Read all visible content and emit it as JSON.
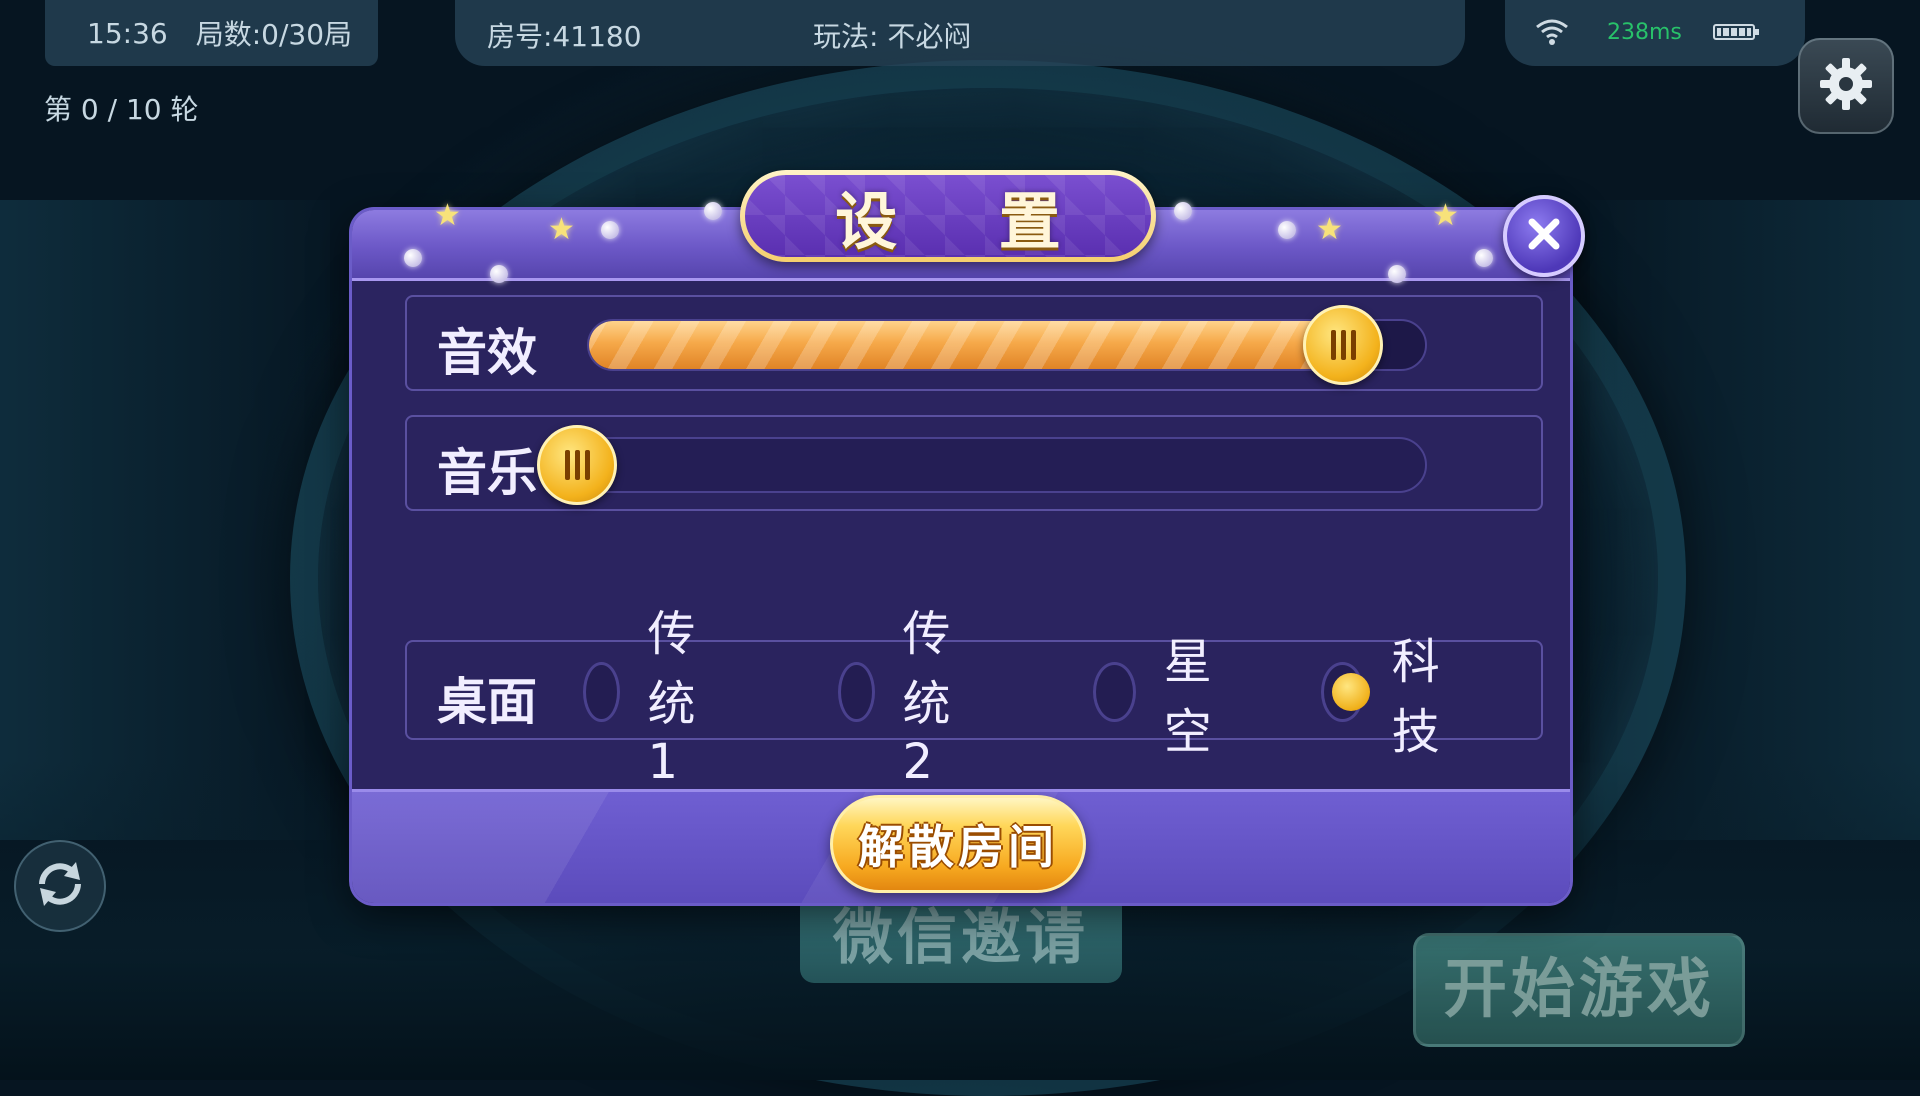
{
  "status_bar": {
    "time": "15:36",
    "rounds": "局数:0/30局",
    "room": "房号:41180",
    "mode": "玩法: 不必闷",
    "ping": "238ms"
  },
  "round_info": "第 0 / 10 轮",
  "dialog": {
    "title": "设  置",
    "sound_effect": {
      "label": "音效",
      "level": 0.9
    },
    "music": {
      "label": "音乐",
      "level": 0.0
    },
    "table_theme": {
      "label": "桌面",
      "options": [
        "传统1",
        "传统2",
        "星空",
        "科技"
      ],
      "selected": "科技"
    },
    "dissolve_button": "解散房间"
  },
  "background_buttons": {
    "invite": "微信邀请",
    "start": "开始游戏"
  },
  "colors": {
    "accent_gold": "#f3b21c",
    "panel_purple": "#2b2460",
    "ping_green": "#28c26a"
  }
}
